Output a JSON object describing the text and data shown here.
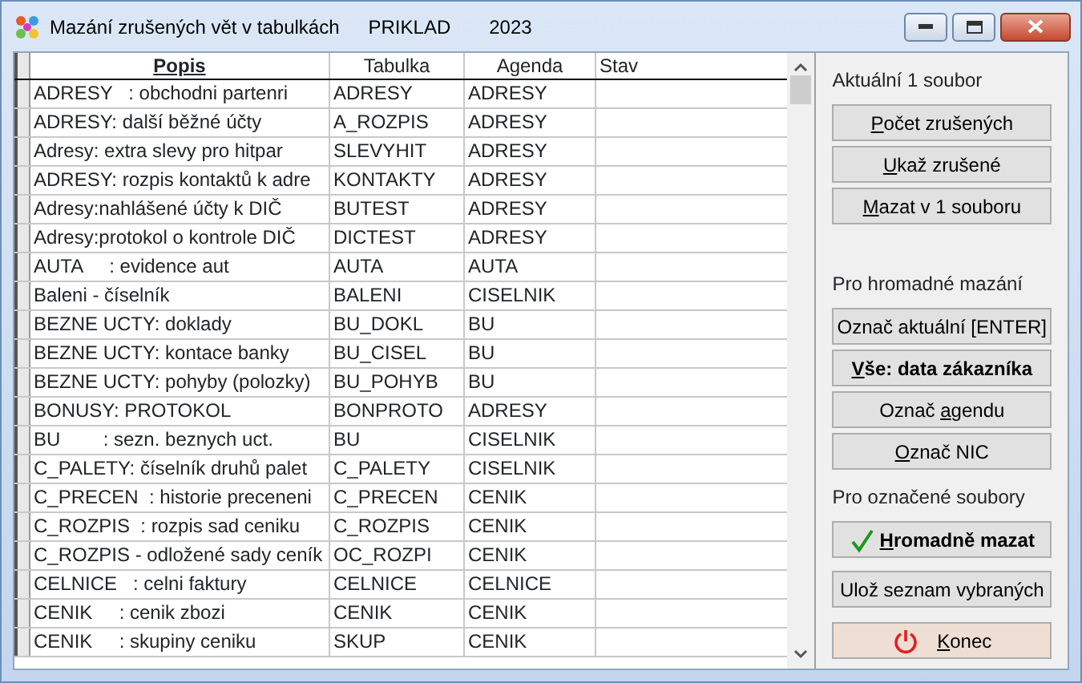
{
  "window": {
    "title": "Mazání zrušených vět v tabulkách",
    "company": "PRIKLAD",
    "year": "2023"
  },
  "table": {
    "columns": [
      "Popis",
      "Tabulka",
      "Agenda",
      "Stav"
    ],
    "rows": [
      [
        "ADRESY   : obchodni partenri",
        "ADRESY",
        "ADRESY"
      ],
      [
        "ADRESY: další běžné účty",
        "A_ROZPIS",
        "ADRESY"
      ],
      [
        "Adresy: extra slevy pro hitpar",
        "SLEVYHIT",
        "ADRESY"
      ],
      [
        "ADRESY: rozpis kontaktů k adre",
        "KONTAKTY",
        "ADRESY"
      ],
      [
        "Adresy:nahlášené účty k DIČ",
        "BUTEST",
        "ADRESY"
      ],
      [
        "Adresy:protokol o kontrole DIČ",
        "DICTEST",
        "ADRESY"
      ],
      [
        "AUTA     : evidence aut",
        "AUTA",
        "AUTA"
      ],
      [
        "Baleni - číselník",
        "BALENI",
        "CISELNIK"
      ],
      [
        "BEZNE UCTY: doklady",
        "BU_DOKL",
        "BU"
      ],
      [
        "BEZNE UCTY: kontace banky",
        "BU_CISEL",
        "BU"
      ],
      [
        "BEZNE UCTY: pohyby (polozky)",
        "BU_POHYB",
        "BU"
      ],
      [
        "BONUSY: PROTOKOL",
        "BONPROTO",
        "ADRESY"
      ],
      [
        "BU        : sezn. beznych uct.",
        "BU",
        "CISELNIK"
      ],
      [
        "C_PALETY: číselník druhů palet",
        "C_PALETY",
        "CISELNIK"
      ],
      [
        "C_PRECEN  : historie preceneni",
        "C_PRECEN",
        "CENIK"
      ],
      [
        "C_ROZPIS  : rozpis sad ceniku",
        "C_ROZPIS",
        "CENIK"
      ],
      [
        "C_ROZPIS - odložené sady ceník",
        "OC_ROZPI",
        "CENIK"
      ],
      [
        "CELNICE   : celni faktury",
        "CELNICE",
        "CELNICE"
      ],
      [
        "CENIK     : cenik zbozi",
        "CENIK",
        "CENIK"
      ],
      [
        "CENIK     : skupiny ceniku",
        "SKUP",
        "CENIK"
      ]
    ]
  },
  "panel": [
    {
      "heading": "Aktuální 1 soubor",
      "buttons": [
        {
          "key": "P",
          "after": "očet zrušených",
          "bold": false,
          "kind": "plain"
        },
        {
          "key": "U",
          "after": "kaž zrušené",
          "bold": false,
          "kind": "plain"
        },
        {
          "key": "M",
          "after": "azat v 1 souboru",
          "bold": false,
          "kind": "plain"
        }
      ]
    },
    {
      "heading": "Pro hromadné mazání",
      "buttons": [
        {
          "before": "Označ aktuální [ENTER]",
          "bold": false,
          "kind": "plain"
        },
        {
          "key": "V",
          "after": "še: data zákazníka",
          "bold": true,
          "kind": "plain"
        },
        {
          "before": "Označ ",
          "key": "a",
          "after": "gendu",
          "bold": false,
          "kind": "plain"
        },
        {
          "key": "O",
          "after": "znač NIC",
          "bold": false,
          "kind": "plain"
        }
      ]
    },
    {
      "heading": "Pro označené soubory",
      "buttons": [
        {
          "key": "H",
          "after": "romadně mazat",
          "bold": true,
          "kind": "confirm"
        }
      ]
    },
    {
      "buttons": [
        {
          "before": "Ulož seznam vybraných",
          "bold": false,
          "kind": "plain"
        }
      ]
    },
    {
      "buttons": [
        {
          "key": "K",
          "after": "onec",
          "bold": false,
          "kind": "exit"
        }
      ]
    }
  ]
}
